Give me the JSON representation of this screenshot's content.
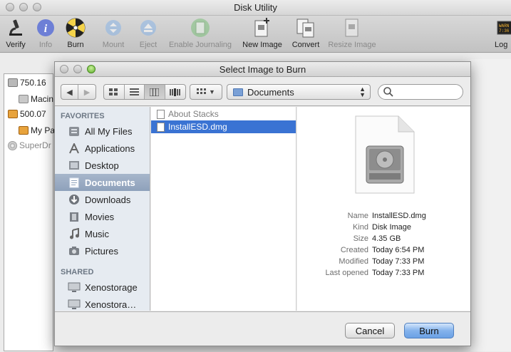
{
  "main_window": {
    "title": "Disk Utility",
    "toolbar": [
      {
        "label": "Verify",
        "icon": "microscope-icon",
        "enabled": true
      },
      {
        "label": "Info",
        "icon": "info-icon",
        "enabled": false
      },
      {
        "label": "Burn",
        "icon": "burn-icon",
        "enabled": true
      },
      {
        "label": "Mount",
        "icon": "mount-icon",
        "enabled": false
      },
      {
        "label": "Eject",
        "icon": "eject-icon",
        "enabled": false
      },
      {
        "label": "Enable Journaling",
        "icon": "journal-icon",
        "enabled": false
      },
      {
        "label": "New Image",
        "icon": "new-image-icon",
        "enabled": true
      },
      {
        "label": "Convert",
        "icon": "convert-icon",
        "enabled": true
      },
      {
        "label": "Resize Image",
        "icon": "resize-image-icon",
        "enabled": false
      },
      {
        "label": "Log",
        "icon": "log-icon",
        "enabled": true
      }
    ],
    "volumes": [
      {
        "label": "750.16"
      },
      {
        "label": "Macin"
      },
      {
        "label": "500.07"
      },
      {
        "label": "My Pa"
      },
      {
        "label": "SuperDr"
      }
    ]
  },
  "sheet": {
    "title": "Select Image to Burn",
    "location": "Documents",
    "search_placeholder": "",
    "favorites_header": "FAVORITES",
    "shared_header": "SHARED",
    "favorites": [
      {
        "label": "All My Files",
        "icon": "all-files-icon"
      },
      {
        "label": "Applications",
        "icon": "applications-icon"
      },
      {
        "label": "Desktop",
        "icon": "desktop-icon"
      },
      {
        "label": "Documents",
        "icon": "documents-icon",
        "selected": true
      },
      {
        "label": "Downloads",
        "icon": "downloads-icon"
      },
      {
        "label": "Movies",
        "icon": "movies-icon"
      },
      {
        "label": "Music",
        "icon": "music-icon"
      },
      {
        "label": "Pictures",
        "icon": "pictures-icon"
      }
    ],
    "shared": [
      {
        "label": "Xenostorage",
        "icon": "network-computer-icon"
      },
      {
        "label": "Xenostora…",
        "icon": "network-computer-icon"
      }
    ],
    "files": [
      {
        "name": "About Stacks",
        "dimmed": true
      },
      {
        "name": "InstallESD.dmg",
        "selected": true
      }
    ],
    "preview": {
      "labels": {
        "name": "Name",
        "kind": "Kind",
        "size": "Size",
        "created": "Created",
        "modified": "Modified",
        "last_opened": "Last opened"
      },
      "values": {
        "name": "InstallESD.dmg",
        "kind": "Disk Image",
        "size": "4.35 GB",
        "created": "Today 6:54 PM",
        "modified": "Today 7:33 PM",
        "last_opened": "Today 7:33 PM"
      }
    },
    "cancel_label": "Cancel",
    "burn_label": "Burn"
  },
  "colors": {
    "selection": "#3a73d3",
    "sidebar_bg": "#e6ebf1",
    "default_button": "#6ba1e5"
  }
}
